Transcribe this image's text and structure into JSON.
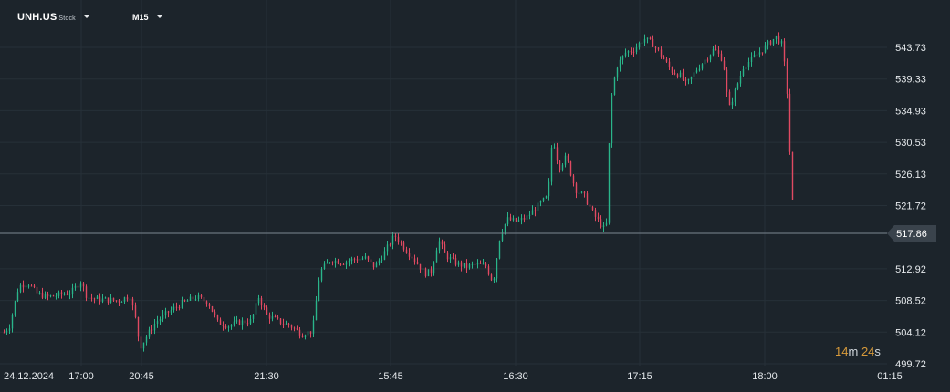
{
  "header": {
    "symbol": "UNH.US",
    "symbol_type": "Stock",
    "timeframe": "M15"
  },
  "countdown": {
    "minutes": "14",
    "minutes_unit": "m",
    "seconds": "24",
    "seconds_unit": "s"
  },
  "colors": {
    "background": "#1c242b",
    "grid": "#263038",
    "up": "#2ab58a",
    "down": "#e04a62",
    "price_line": "#7c8791",
    "price_tag": "#3a434c",
    "countdown": "#d79a3a"
  },
  "chart_data": {
    "type": "candlestick",
    "title": "",
    "xlabel": "",
    "ylabel": "",
    "ylim": [
      499.0,
      548.0
    ],
    "y_ticks": [
      "543.73",
      "539.33",
      "534.93",
      "530.53",
      "526.13",
      "521.72",
      "517.86",
      "512.92",
      "508.52",
      "504.12",
      "499.72"
    ],
    "current_price": "517.86",
    "x_ticks": [
      "24.12.2024",
      "17:00",
      "20:45",
      "21:30",
      "15:45",
      "16:30",
      "17:15",
      "18:00",
      "01:15"
    ],
    "grid": true,
    "series": [
      {
        "name": "UNH.US",
        "anchors": [
          [
            0,
            503.5
          ],
          [
            10,
            505.0
          ],
          [
            20,
            510.5
          ],
          [
            30,
            511.0
          ],
          [
            40,
            509.5
          ],
          [
            52,
            509.0
          ],
          [
            65,
            509.3
          ],
          [
            78,
            509.7
          ],
          [
            88,
            511.2
          ],
          [
            95,
            509.0
          ],
          [
            105,
            508.7
          ],
          [
            118,
            508.6
          ],
          [
            130,
            508.5
          ],
          [
            142,
            509.2
          ],
          [
            148,
            506.0
          ],
          [
            153,
            502.0
          ],
          [
            160,
            503.5
          ],
          [
            170,
            505.5
          ],
          [
            185,
            507.0
          ],
          [
            200,
            508.2
          ],
          [
            215,
            509.0
          ],
          [
            228,
            508.2
          ],
          [
            238,
            505.5
          ],
          [
            250,
            505.0
          ],
          [
            262,
            505.5
          ],
          [
            275,
            505.7
          ],
          [
            283,
            509.0
          ],
          [
            292,
            506.5
          ],
          [
            305,
            505.6
          ],
          [
            318,
            505.0
          ],
          [
            330,
            503.8
          ],
          [
            342,
            504.3
          ],
          [
            350,
            512.5
          ],
          [
            362,
            514.2
          ],
          [
            375,
            513.8
          ],
          [
            388,
            514.3
          ],
          [
            400,
            514.4
          ],
          [
            410,
            513.2
          ],
          [
            420,
            515.0
          ],
          [
            432,
            517.6
          ],
          [
            445,
            515.5
          ],
          [
            455,
            514.0
          ],
          [
            465,
            512.3
          ],
          [
            472,
            512.5
          ],
          [
            480,
            517.0
          ],
          [
            488,
            514.8
          ],
          [
            498,
            513.8
          ],
          [
            510,
            513.2
          ],
          [
            522,
            513.5
          ],
          [
            532,
            513.3
          ],
          [
            540,
            511.0
          ],
          [
            548,
            518.0
          ],
          [
            556,
            519.8
          ],
          [
            566,
            519.5
          ],
          [
            576,
            520.0
          ],
          [
            590,
            521.8
          ],
          [
            600,
            523.0
          ],
          [
            605,
            531.5
          ],
          [
            612,
            527.0
          ],
          [
            620,
            528.5
          ],
          [
            630,
            524.0
          ],
          [
            640,
            523.0
          ],
          [
            650,
            520.5
          ],
          [
            662,
            518.4
          ],
          [
            665,
            519.5
          ],
          [
            668,
            535.5
          ],
          [
            675,
            541.0
          ],
          [
            685,
            543.0
          ],
          [
            695,
            543.5
          ],
          [
            705,
            545.0
          ],
          [
            715,
            544.2
          ],
          [
            725,
            542.5
          ],
          [
            735,
            540.5
          ],
          [
            745,
            539.8
          ],
          [
            752,
            538.5
          ],
          [
            762,
            540.5
          ],
          [
            772,
            542.0
          ],
          [
            782,
            543.5
          ],
          [
            792,
            542.0
          ],
          [
            798,
            535.0
          ],
          [
            806,
            538.0
          ],
          [
            814,
            541.0
          ],
          [
            824,
            542.2
          ],
          [
            834,
            543.3
          ],
          [
            842,
            544.3
          ],
          [
            850,
            545.2
          ],
          [
            857,
            544.0
          ],
          [
            862,
            537.5
          ],
          [
            866,
            526.5
          ],
          [
            870,
            518.0
          ]
        ]
      }
    ]
  }
}
